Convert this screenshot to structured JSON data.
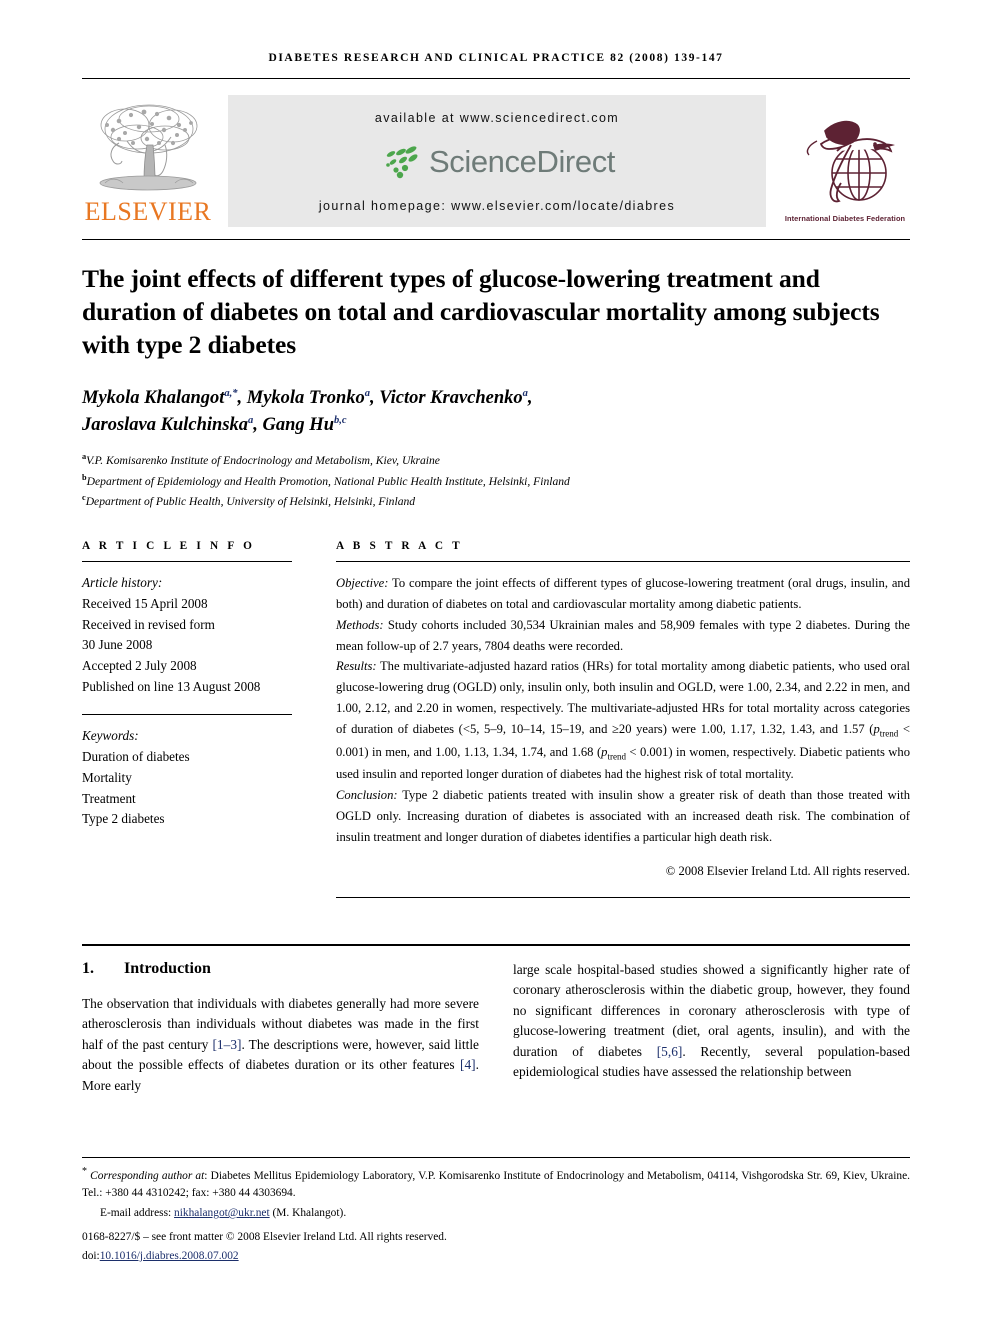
{
  "running_head": "DIABETES RESEARCH AND CLINICAL PRACTICE 82 (2008) 139-147",
  "banner": {
    "available_at": "available at www.sciencedirect.com",
    "journal_homepage": "journal homepage: www.elsevier.com/locate/diabres",
    "sciencedirect_word": "ScienceDirect",
    "elsevier_word": "ELSEVIER",
    "idf_caption": "International Diabetes Federation"
  },
  "article": {
    "title": "The joint effects of different types of glucose-lowering treatment and duration of diabetes on total and cardiovascular mortality among subjects with type 2 diabetes",
    "authors_line1": "Mykola Khalangot",
    "authors_line1_sup1": "a,*",
    "authors_line1_b": ", Mykola Tronko",
    "authors_line1_sup2": "a",
    "authors_line1_c": ", Victor Kravchenko",
    "authors_line1_sup3": "a",
    "authors_line1_d": ",",
    "authors_line2": "Jaroslava Kulchinska",
    "authors_line2_sup1": "a",
    "authors_line2_b": ", Gang Hu",
    "authors_line2_sup2": "b,c",
    "affiliations": [
      {
        "marker": "a",
        "text": "V.P. Komisarenko Institute of Endocrinology and Metabolism, Kiev, Ukraine"
      },
      {
        "marker": "b",
        "text": "Department of Epidemiology and Health Promotion, National Public Health Institute, Helsinki, Finland"
      },
      {
        "marker": "c",
        "text": "Department of Public Health, University of Helsinki, Helsinki, Finland"
      }
    ]
  },
  "article_info": {
    "heading": "A R T I C L E    I N F O",
    "history_label": "Article history:",
    "history": [
      "Received 15 April 2008",
      "Received in revised form",
      "30 June 2008",
      "Accepted 2 July 2008",
      "Published on line 13 August 2008"
    ],
    "keywords_label": "Keywords:",
    "keywords": [
      "Duration of diabetes",
      "Mortality",
      "Treatment",
      "Type 2 diabetes"
    ]
  },
  "abstract": {
    "heading": "A B S T R A C T",
    "objective_label": "Objective:",
    "objective_text": " To compare the joint effects of different types of glucose-lowering treatment (oral drugs, insulin, and both) and duration of diabetes on total and cardiovascular mortality among diabetic patients.",
    "methods_label": "Methods:",
    "methods_text": " Study cohorts included 30,534 Ukrainian males and 58,909 females with type 2 diabetes. During the mean follow-up of 2.7 years, 7804 deaths were recorded.",
    "results_label": "Results:",
    "results_text_a": " The multivariate-adjusted hazard ratios (HRs) for total mortality among diabetic patients, who used oral glucose-lowering drug (OGLD) only, insulin only, both insulin and OGLD, were 1.00, 2.34, and 2.22 in men, and 1.00, 2.12, and 2.20 in women, respectively. The multivariate-adjusted HRs for total mortality across categories of duration of diabetes (<5, 5–9, 10–14, 15–19, and ≥20 years) were 1.00, 1.17, 1.32, 1.43, and 1.57 (",
    "results_p1": "p",
    "results_p1_sub": "trend",
    "results_text_b": " < 0.001) in men, and 1.00, 1.13, 1.34, 1.74, and 1.68 (",
    "results_p2": "p",
    "results_p2_sub": "trend",
    "results_text_c": " < 0.001) in women, respectively. Diabetic patients who used insulin and reported longer duration of diabetes had the highest risk of total mortality.",
    "conclusion_label": "Conclusion:",
    "conclusion_text": " Type 2 diabetic patients treated with insulin show a greater risk of death than those treated with OGLD only. Increasing duration of diabetes is associated with an increased death risk. The combination of insulin treatment and longer duration of diabetes identifies a particular high death risk.",
    "copyright": "© 2008 Elsevier Ireland Ltd. All rights reserved."
  },
  "introduction": {
    "number": "1.",
    "heading": "Introduction",
    "left_a": "The observation that individuals with diabetes generally had more severe atherosclerosis than individuals without diabetes was made in the first half of the past century ",
    "left_ref1": "[1–3]",
    "left_b": ". The descriptions were, however, said little about the possible effects of diabetes duration or its other features ",
    "left_ref2": "[4]",
    "left_c": ". More early",
    "right_a": "large scale hospital-based studies showed a significantly higher rate of coronary atherosclerosis within the diabetic group, however, they found no significant differences in coronary atherosclerosis with type of glucose-lowering treatment (diet, oral agents, insulin), and with the duration of diabetes ",
    "right_ref1": "[5,6]",
    "right_b": ". Recently, several population-based epidemiological studies have assessed the relationship between"
  },
  "footnotes": {
    "corresponding_label": "Corresponding author at",
    "corresponding_text": ": Diabetes Mellitus Epidemiology Laboratory, V.P. Komisarenko Institute of Endocrinology and Metabolism, 04114, Vishgorodska Str. 69, Kiev, Ukraine. Tel.: +380 44 4310242; fax: +380 44 4303694.",
    "email_label": "E-mail address:",
    "email": "nikhalangot@ukr.net",
    "email_suffix": " (M. Khalangot).",
    "issn_line": "0168-8227/$ – see front matter © 2008 Elsevier Ireland Ltd. All rights reserved.",
    "doi_prefix": "doi:",
    "doi": "10.1016/j.diabres.2008.07.002"
  },
  "colors": {
    "elsevier_orange": "#E87722",
    "sciencedirect_green": "#4CA64C",
    "sciencedirect_gray": "#6e7b78",
    "idf_maroon": "#5d2233",
    "link_blue": "#1c2f6b",
    "banner_bg": "#e8e8e8"
  }
}
